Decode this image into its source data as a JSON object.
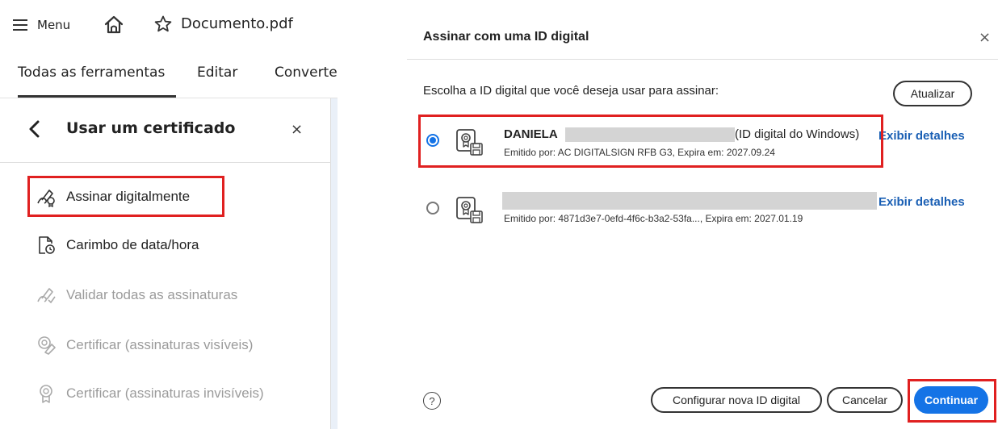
{
  "topbar": {
    "menu_label": "Menu",
    "document_title": "Documento.pdf"
  },
  "tabs": [
    {
      "label": "Todas as ferramentas"
    },
    {
      "label": "Editar"
    },
    {
      "label": "Converte"
    }
  ],
  "panel": {
    "title": "Usar um certificado",
    "close": "×",
    "tools": [
      {
        "label": "Assinar digitalmente",
        "enabled": true,
        "icon": "sign-pen-icon"
      },
      {
        "label": "Carimbo de data/hora",
        "enabled": true,
        "icon": "timestamp-icon"
      },
      {
        "label": "Validar todas as assinaturas",
        "enabled": false,
        "icon": "validate-signatures-icon"
      },
      {
        "label": "Certificar (assinaturas visíveis)",
        "enabled": false,
        "icon": "certify-visible-icon"
      },
      {
        "label": "Certificar (assinaturas invisíveis)",
        "enabled": false,
        "icon": "certify-invisible-icon"
      }
    ]
  },
  "dialog": {
    "title": "Assinar com uma ID digital",
    "close": "×",
    "prompt": "Escolha a ID digital que você deseja usar para assinar:",
    "refresh_label": "Atualizar",
    "ids": [
      {
        "name": "DANIELA",
        "type": "(ID digital do Windows)",
        "meta": "Emitido por: AC DIGITALSIGN RFB G3, Expira em: 2027.09.24",
        "selected": true,
        "details_label": "Exibir detalhes"
      },
      {
        "name": "",
        "type": "",
        "meta": "Emitido por: 4871d3e7-0efd-4f6c-b3a2-53fa..., Expira em: 2027.01.19",
        "selected": false,
        "details_label": "Exibir detalhes"
      }
    ],
    "help": "?",
    "configure_label": "Configurar nova ID digital",
    "cancel_label": "Cancelar",
    "continue_label": "Continuar"
  },
  "colors": {
    "accent": "#1473e6",
    "highlight": "#e02020",
    "link": "#1a5fb4",
    "disabled": "#9b9b9b"
  }
}
